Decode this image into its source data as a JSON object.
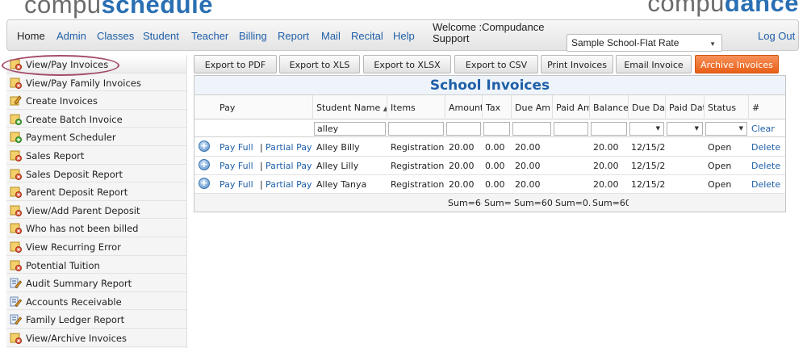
{
  "brand": {
    "left_light": "compu",
    "left_bold": "schedule",
    "right_light": "compu",
    "right_bold": "dance"
  },
  "nav": {
    "items": [
      "Home",
      "Admin",
      "Classes",
      "Student",
      "Teacher",
      "Billing",
      "Report",
      "Mail",
      "Recital",
      "Help"
    ],
    "welcome": "Welcome :Compudance Support",
    "school_select": "Sample School-Flat Rate",
    "logout": "Log Out"
  },
  "sidebar": {
    "items": [
      {
        "label": "View/Pay Invoices",
        "icon": "invoice-tag-icon"
      },
      {
        "label": "View/Pay Family Invoices",
        "icon": "invoice-tag-icon"
      },
      {
        "label": "Create Invoices",
        "icon": "edit-pencil-icon"
      },
      {
        "label": "Create Batch Invoice",
        "icon": "invoice-add-icon"
      },
      {
        "label": "Payment Scheduler",
        "icon": "invoice-add-icon"
      },
      {
        "label": "Sales Report",
        "icon": "invoice-tag-icon"
      },
      {
        "label": "Sales Deposit Report",
        "icon": "invoice-tag-icon"
      },
      {
        "label": "Parent Deposit Report",
        "icon": "invoice-tag-icon"
      },
      {
        "label": "View/Add Parent Deposit",
        "icon": "invoice-tag-icon"
      },
      {
        "label": "Who has not been billed",
        "icon": "invoice-tag-icon"
      },
      {
        "label": "View Recurring Error",
        "icon": "invoice-tag-icon"
      },
      {
        "label": "Potential Tuition",
        "icon": "invoice-tag-icon"
      },
      {
        "label": "Audit Summary Report",
        "icon": "report-pencil-icon"
      },
      {
        "label": "Accounts Receivable",
        "icon": "report-pencil-icon"
      },
      {
        "label": "Family Ledger Report",
        "icon": "report-pencil-icon"
      },
      {
        "label": "View/Archive Invoices",
        "icon": "invoice-tag-icon"
      }
    ]
  },
  "toolbar": {
    "buttons": [
      "Export to PDF",
      "Export to XLS",
      "Export to XLSX",
      "Export to CSV",
      "Print Invoices",
      "Email Invoice",
      "Archive Invoices"
    ]
  },
  "grid": {
    "title": "School Invoices",
    "headers": [
      "Pay",
      "Student Name",
      "Items",
      "Amount",
      "Tax",
      "Due Am",
      "Paid Am",
      "Balance",
      "Due Dat",
      "Paid Dat",
      "Status",
      "#"
    ],
    "filter_student": "alley",
    "clear": "Clear",
    "rows": [
      {
        "pay_full": "Pay Full",
        "sep": "|",
        "partial": "Partial Pay",
        "student": "Alley Billy",
        "items": "Registration",
        "amount": "20.00",
        "tax": "0.00",
        "due": "20.00",
        "paid": "",
        "balance": "20.00",
        "due_date": "12/15/2",
        "paid_date": "",
        "status": "Open",
        "action": "Delete"
      },
      {
        "pay_full": "Pay Full",
        "sep": "|",
        "partial": "Partial Pay",
        "student": "Alley Lilly",
        "items": "Registration",
        "amount": "20.00",
        "tax": "0.00",
        "due": "20.00",
        "paid": "",
        "balance": "20.00",
        "due_date": "12/15/2",
        "paid_date": "",
        "status": "Open",
        "action": "Delete"
      },
      {
        "pay_full": "Pay Full",
        "sep": "|",
        "partial": "Partial Pay",
        "student": "Alley Tanya",
        "items": "Registration",
        "amount": "20.00",
        "tax": "0.00",
        "due": "20.00",
        "paid": "",
        "balance": "20.00",
        "due_date": "12/15/2",
        "paid_date": "",
        "status": "Open",
        "action": "Delete"
      }
    ],
    "sums": [
      "Sum=6(",
      "Sum=",
      "Sum=60",
      "Sum=0.",
      "Sum=60"
    ]
  },
  "colors": {
    "link": "#1f5fa8",
    "archive": "#e85f16",
    "highlight_ring": "#a34a6a"
  }
}
